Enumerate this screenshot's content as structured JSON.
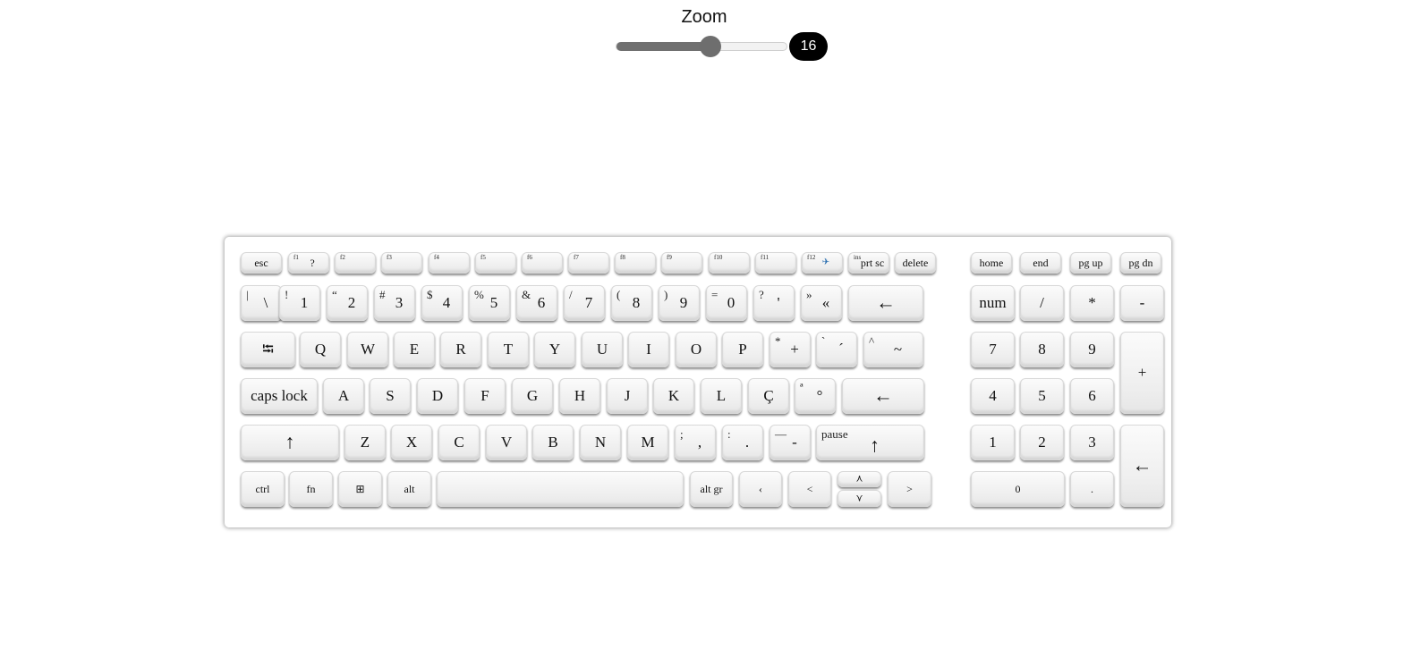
{
  "zoom": {
    "label": "Zoom",
    "value": "16",
    "fraction": 0.55
  },
  "keyboard": {
    "keys": [
      {
        "name": "key-esc",
        "label": "esc",
        "sub": "",
        "type": "fn"
      },
      {
        "name": "key-f1",
        "label": "?",
        "sub": "f1",
        "type": "fn"
      },
      {
        "name": "key-f2",
        "label": "",
        "sub": "f2",
        "type": "fn"
      },
      {
        "name": "key-f3",
        "label": "",
        "sub": "f3",
        "type": "fn"
      },
      {
        "name": "key-f4",
        "label": "",
        "sub": "f4",
        "type": "fn"
      },
      {
        "name": "key-f5",
        "label": "",
        "sub": "f5",
        "type": "fn"
      },
      {
        "name": "key-f6",
        "label": "",
        "sub": "f6",
        "type": "fn"
      },
      {
        "name": "key-f7",
        "label": "",
        "sub": "f7",
        "type": "fn"
      },
      {
        "name": "key-f8",
        "label": "",
        "sub": "f8",
        "type": "fn"
      },
      {
        "name": "key-f9",
        "label": "",
        "sub": "f9",
        "type": "fn"
      },
      {
        "name": "key-f10",
        "label": "",
        "sub": "f10",
        "type": "fn"
      },
      {
        "name": "key-f11",
        "label": "",
        "sub": "f11",
        "type": "fn"
      },
      {
        "name": "key-f12",
        "label": "✈",
        "sub": "f12",
        "type": "fn"
      },
      {
        "name": "key-prt-sc",
        "label": "prt sc",
        "sub": "ins",
        "type": "fn"
      },
      {
        "name": "key-delete",
        "label": "delete",
        "sub": "",
        "type": "fn"
      },
      {
        "name": "key-home",
        "label": "home",
        "sub": "",
        "type": "fn"
      },
      {
        "name": "key-end",
        "label": "end",
        "sub": "",
        "type": "fn"
      },
      {
        "name": "key-pg-up",
        "label": "pg up",
        "sub": "",
        "type": "fn"
      },
      {
        "name": "key-pg-dn",
        "label": "pg dn",
        "sub": "",
        "type": "fn"
      },
      {
        "name": "key-backslash",
        "label": "\\",
        "sub": "|",
        "type": "norm"
      },
      {
        "name": "key-1",
        "label": "1",
        "sub": "!",
        "type": "norm"
      },
      {
        "name": "key-2",
        "label": "2",
        "sub": "“",
        "type": "norm"
      },
      {
        "name": "key-3",
        "label": "3",
        "sub": "#",
        "type": "norm"
      },
      {
        "name": "key-4",
        "label": "4",
        "sub": "$",
        "type": "norm"
      },
      {
        "name": "key-5",
        "label": "5",
        "sub": "%",
        "type": "norm"
      },
      {
        "name": "key-6",
        "label": "6",
        "sub": "&",
        "type": "norm"
      },
      {
        "name": "key-7",
        "label": "7",
        "sub": "/",
        "type": "norm"
      },
      {
        "name": "key-8",
        "label": "8",
        "sub": "(",
        "type": "norm"
      },
      {
        "name": "key-9",
        "label": "9",
        "sub": ")",
        "type": "norm"
      },
      {
        "name": "key-0",
        "label": "0",
        "sub": "=",
        "type": "norm"
      },
      {
        "name": "key-apostrophe",
        "label": "'",
        "sub": "?",
        "type": "norm"
      },
      {
        "name": "key-guillemet",
        "label": "«",
        "sub": "»",
        "type": "norm"
      },
      {
        "name": "key-backspace",
        "label": "←",
        "sub": "",
        "type": "big"
      },
      {
        "name": "key-num",
        "label": "num",
        "sub": "",
        "type": "norm"
      },
      {
        "name": "key-num-slash",
        "label": "/",
        "sub": "",
        "type": "norm"
      },
      {
        "name": "key-num-asterisk",
        "label": "*",
        "sub": "",
        "type": "norm"
      },
      {
        "name": "key-num-minus",
        "label": "-",
        "sub": "",
        "type": "norm"
      },
      {
        "name": "key-tab",
        "label": "⭾",
        "sub": "",
        "type": "norm"
      },
      {
        "name": "key-q",
        "label": "Q",
        "sub": "",
        "type": "norm"
      },
      {
        "name": "key-w",
        "label": "W",
        "sub": "",
        "type": "norm"
      },
      {
        "name": "key-e",
        "label": "E",
        "sub": "",
        "type": "norm"
      },
      {
        "name": "key-r",
        "label": "R",
        "sub": "",
        "type": "norm"
      },
      {
        "name": "key-t",
        "label": "T",
        "sub": "",
        "type": "norm"
      },
      {
        "name": "key-y",
        "label": "Y",
        "sub": "",
        "type": "norm"
      },
      {
        "name": "key-u",
        "label": "U",
        "sub": "",
        "type": "norm"
      },
      {
        "name": "key-i",
        "label": "I",
        "sub": "",
        "type": "norm"
      },
      {
        "name": "key-o",
        "label": "O",
        "sub": "",
        "type": "norm"
      },
      {
        "name": "key-p",
        "label": "P",
        "sub": "",
        "type": "norm"
      },
      {
        "name": "key-plus",
        "label": "+",
        "sub": "*",
        "type": "norm"
      },
      {
        "name": "key-acute",
        "label": "´",
        "sub": "`",
        "type": "norm"
      },
      {
        "name": "key-tilde",
        "label": "~",
        "sub": "^",
        "type": "norm"
      },
      {
        "name": "key-num-7",
        "label": "7",
        "sub": "",
        "type": "norm"
      },
      {
        "name": "key-num-8",
        "label": "8",
        "sub": "",
        "type": "norm"
      },
      {
        "name": "key-num-9",
        "label": "9",
        "sub": "",
        "type": "norm"
      },
      {
        "name": "key-num-plus",
        "label": "+",
        "sub": "",
        "type": "norm"
      },
      {
        "name": "key-caps-lock",
        "label": "caps lock",
        "sub": "",
        "type": "norm"
      },
      {
        "name": "key-a",
        "label": "A",
        "sub": "",
        "type": "norm"
      },
      {
        "name": "key-s",
        "label": "S",
        "sub": "",
        "type": "norm"
      },
      {
        "name": "key-d",
        "label": "D",
        "sub": "",
        "type": "norm"
      },
      {
        "name": "key-f",
        "label": "F",
        "sub": "",
        "type": "norm"
      },
      {
        "name": "key-g",
        "label": "G",
        "sub": "",
        "type": "norm"
      },
      {
        "name": "key-h",
        "label": "H",
        "sub": "",
        "type": "norm"
      },
      {
        "name": "key-j",
        "label": "J",
        "sub": "",
        "type": "norm"
      },
      {
        "name": "key-k",
        "label": "K",
        "sub": "",
        "type": "norm"
      },
      {
        "name": "key-l",
        "label": "L",
        "sub": "",
        "type": "norm"
      },
      {
        "name": "key-c-cedilla",
        "label": "Ç",
        "sub": "",
        "type": "norm"
      },
      {
        "name": "key-degree",
        "label": "°",
        "sub": "ª",
        "type": "norm"
      },
      {
        "name": "key-enter",
        "label": "←",
        "sub": "",
        "type": "big"
      },
      {
        "name": "key-num-4",
        "label": "4",
        "sub": "",
        "type": "norm"
      },
      {
        "name": "key-num-5",
        "label": "5",
        "sub": "",
        "type": "norm"
      },
      {
        "name": "key-num-6",
        "label": "6",
        "sub": "",
        "type": "norm"
      },
      {
        "name": "key-left-shift",
        "label": "↑",
        "sub": "",
        "type": "big"
      },
      {
        "name": "key-z",
        "label": "Z",
        "sub": "",
        "type": "norm"
      },
      {
        "name": "key-x",
        "label": "X",
        "sub": "",
        "type": "norm"
      },
      {
        "name": "key-c",
        "label": "C",
        "sub": "",
        "type": "norm"
      },
      {
        "name": "key-v",
        "label": "V",
        "sub": "",
        "type": "norm"
      },
      {
        "name": "key-b",
        "label": "B",
        "sub": "",
        "type": "norm"
      },
      {
        "name": "key-n",
        "label": "N",
        "sub": "",
        "type": "norm"
      },
      {
        "name": "key-m",
        "label": "M",
        "sub": "",
        "type": "norm"
      },
      {
        "name": "key-comma",
        "label": ",",
        "sub": ";",
        "type": "norm"
      },
      {
        "name": "key-period",
        "label": ".",
        "sub": ":",
        "type": "norm"
      },
      {
        "name": "key-minus",
        "label": "-",
        "sub": "—",
        "type": "norm"
      },
      {
        "name": "key-right-shift",
        "label": "↑",
        "sub": "pause",
        "type": "big"
      },
      {
        "name": "key-num-1",
        "label": "1",
        "sub": "",
        "type": "norm"
      },
      {
        "name": "key-num-2",
        "label": "2",
        "sub": "",
        "type": "norm"
      },
      {
        "name": "key-num-3",
        "label": "3",
        "sub": "",
        "type": "norm"
      },
      {
        "name": "key-num-enter",
        "label": "←",
        "sub": "",
        "type": "big"
      },
      {
        "name": "key-ctrl",
        "label": "ctrl",
        "sub": "",
        "type": "mod"
      },
      {
        "name": "key-fn",
        "label": "fn",
        "sub": "",
        "type": "mod"
      },
      {
        "name": "key-windows",
        "label": "⊞",
        "sub": "",
        "type": "mod"
      },
      {
        "name": "key-alt",
        "label": "alt",
        "sub": "",
        "type": "mod"
      },
      {
        "name": "key-space",
        "label": "",
        "sub": "",
        "type": "mod"
      },
      {
        "name": "key-alt-gr",
        "label": "alt gr",
        "sub": "",
        "type": "mod"
      },
      {
        "name": "key-arrow-left",
        "label": "‹",
        "sub": "",
        "type": "mod"
      },
      {
        "name": "key-less-than",
        "label": "<",
        "sub": "",
        "type": "mod"
      },
      {
        "name": "key-arrow-up",
        "label": "⋏",
        "sub": "",
        "type": "mod"
      },
      {
        "name": "key-arrow-down",
        "label": "⋎",
        "sub": "",
        "type": "mod"
      },
      {
        "name": "key-greater-than",
        "label": ">",
        "sub": "",
        "type": "mod"
      },
      {
        "name": "key-num-0",
        "label": "0",
        "sub": "",
        "type": "mod"
      },
      {
        "name": "key-num-period",
        "label": ".",
        "sub": "",
        "type": "mod"
      }
    ]
  }
}
